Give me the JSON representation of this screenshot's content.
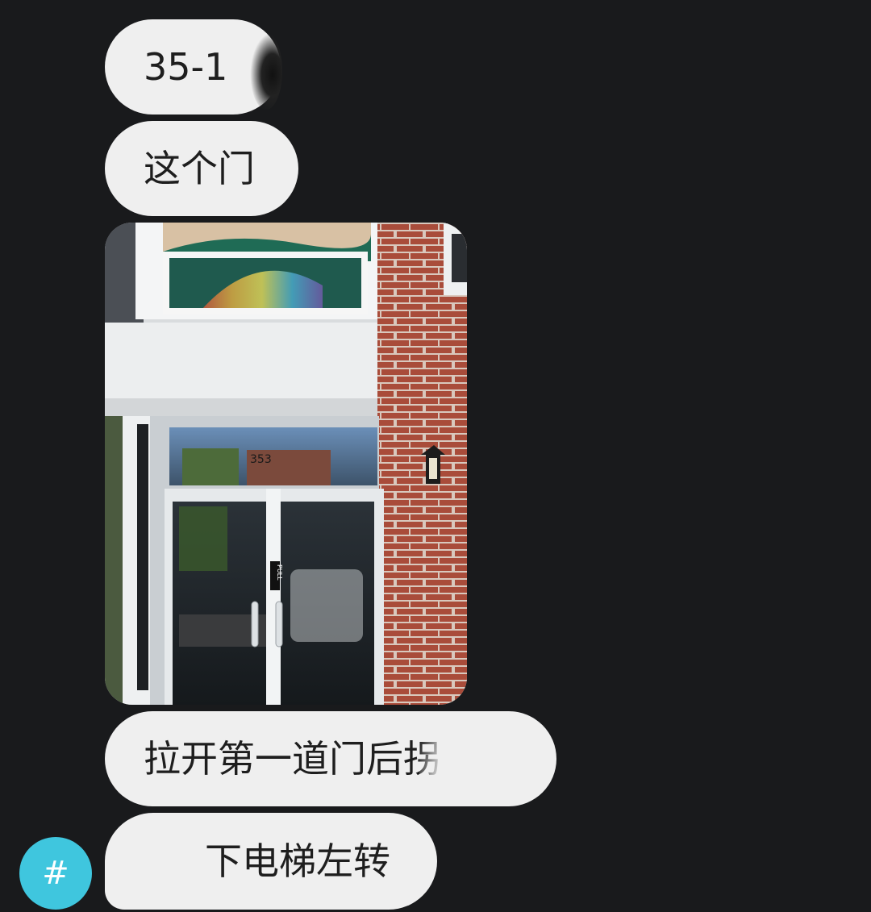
{
  "messages": [
    {
      "id": "m1",
      "type": "text",
      "text": "35-1"
    },
    {
      "id": "m2",
      "type": "text",
      "text": "这个门"
    },
    {
      "id": "m3",
      "type": "image",
      "image_label": "building-entrance-photo",
      "door_number": "353",
      "door_sign": "PULL"
    },
    {
      "id": "m4",
      "type": "text",
      "text": "拉开第一道门后拐"
    },
    {
      "id": "m5",
      "type": "text",
      "text": "下电梯左转"
    }
  ],
  "sender_avatar": {
    "glyph": "#",
    "color": "#3fc6de"
  },
  "colors": {
    "background": "#191a1c",
    "bubble": "#efefef",
    "bubble_text": "#1e1e1e"
  }
}
